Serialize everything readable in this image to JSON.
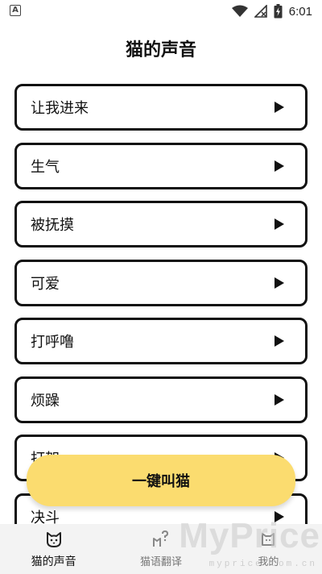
{
  "status_bar": {
    "time": "6:01",
    "left_badge": "A",
    "icons": [
      "wifi-icon",
      "signal-icon",
      "battery-icon"
    ]
  },
  "header": {
    "title": "猫的声音"
  },
  "sounds": [
    {
      "label": "让我进来"
    },
    {
      "label": "生气"
    },
    {
      "label": "被抚摸"
    },
    {
      "label": "可爱"
    },
    {
      "label": "打呼噜"
    },
    {
      "label": "烦躁"
    },
    {
      "label": "打架"
    },
    {
      "label": "决斗"
    }
  ],
  "meow_button": {
    "label": "一键叫猫"
  },
  "bottom_nav": {
    "tabs": [
      {
        "label": "猫的声音",
        "icon": "cat-face-icon",
        "active": true
      },
      {
        "label": "猫语翻译",
        "icon": "cat-question-icon",
        "active": false
      },
      {
        "label": "我的",
        "icon": "cat-profile-icon",
        "active": false
      }
    ]
  },
  "watermark": {
    "main": "MyPrice",
    "sub": "myprice.com.cn"
  },
  "colors": {
    "accent_yellow": "#fbdc6f",
    "border": "#111111",
    "nav_bg": "#f3f3f3"
  }
}
